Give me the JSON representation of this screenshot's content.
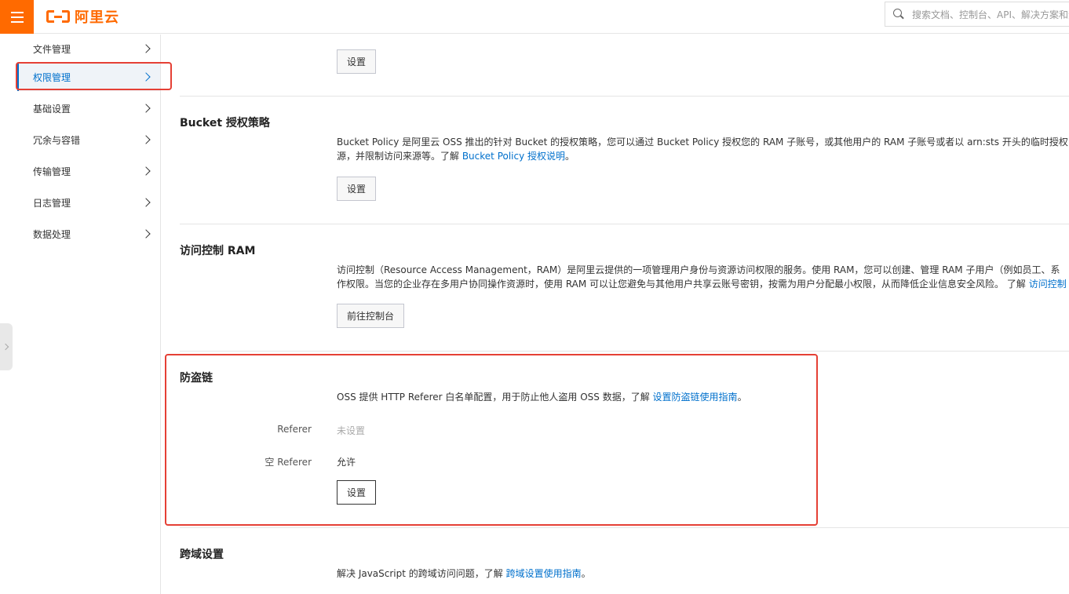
{
  "topbar": {
    "logo_text": "阿里云",
    "search_placeholder": "搜索文档、控制台、API、解决方案和资源"
  },
  "sidebar": {
    "items": [
      {
        "label": "文件管理"
      },
      {
        "label": "权限管理"
      },
      {
        "label": "基础设置"
      },
      {
        "label": "冗余与容错"
      },
      {
        "label": "传输管理"
      },
      {
        "label": "日志管理"
      },
      {
        "label": "数据处理"
      }
    ]
  },
  "sections": {
    "top": {
      "button": "设置"
    },
    "bucket_policy": {
      "title": "Bucket 授权策略",
      "desc_line1": "Bucket Policy 是阿里云 OSS 推出的针对 Bucket 的授权策略，您可以通过 Bucket Policy 授权您的 RAM 子账号，或其他用户的 RAM 子账号或者以 arn:sts 开头的临时授权",
      "desc_line2_prefix": "源，并限制访问来源等。了解 ",
      "desc_link": "Bucket Policy 授权说明",
      "desc_suffix": "。",
      "button": "设置"
    },
    "ram": {
      "title": "访问控制 RAM",
      "desc_line1": "访问控制（Resource Access Management，RAM）是阿里云提供的一项管理用户身份与资源访问权限的服务。使用 RAM，您可以创建、管理 RAM 子用户（例如员工、系",
      "desc_line2_prefix": "作权限。当您的企业存在多用户协同操作资源时，使用 RAM 可以让您避免与其他用户共享云账号密钥，按需为用户分配最小权限，从而降低企业信息安全风险。 了解 ",
      "desc_link": "访问控制",
      "button": "前往控制台"
    },
    "hotlink": {
      "title": "防盗链",
      "desc_prefix": "OSS 提供 HTTP Referer 白名单配置，用于防止他人盗用 OSS 数据，了解 ",
      "desc_link": "设置防盗链使用指南",
      "desc_suffix": "。",
      "referer_label": "Referer",
      "referer_value": "未设置",
      "empty_referer_label": "空 Referer",
      "empty_referer_value": "允许",
      "button": "设置"
    },
    "cors": {
      "title": "跨域设置",
      "desc_prefix": "解决 JavaScript 的跨域访问问题，了解 ",
      "desc_link": "跨域设置使用指南",
      "desc_suffix": "。"
    }
  },
  "colors": {
    "brand": "#ff6a00",
    "link": "#0070cc",
    "highlight_box": "#e54035"
  }
}
